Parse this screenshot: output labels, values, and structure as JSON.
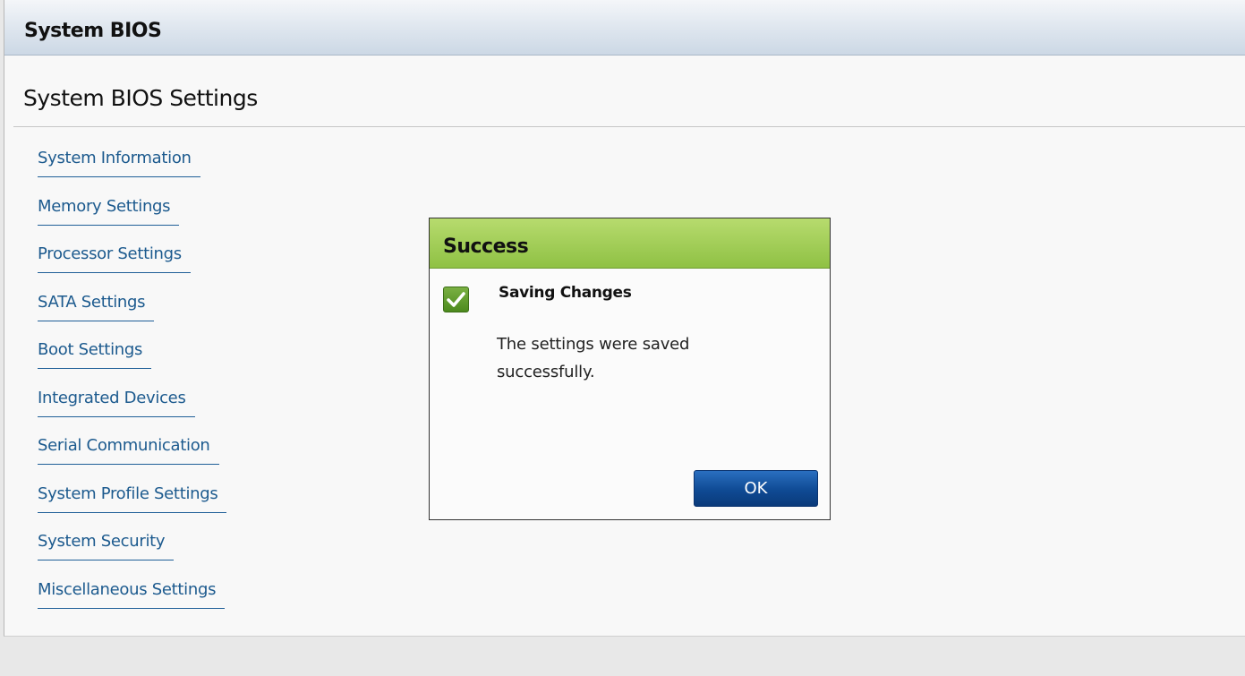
{
  "header": {
    "title": "System BIOS"
  },
  "section": {
    "title": "System BIOS Settings"
  },
  "nav": {
    "items": [
      {
        "label": "System Information"
      },
      {
        "label": "Memory Settings"
      },
      {
        "label": "Processor Settings"
      },
      {
        "label": "SATA Settings"
      },
      {
        "label": "Boot Settings"
      },
      {
        "label": "Integrated Devices"
      },
      {
        "label": "Serial Communication"
      },
      {
        "label": "System Profile Settings"
      },
      {
        "label": "System Security"
      },
      {
        "label": "Miscellaneous Settings"
      }
    ]
  },
  "dialog": {
    "title": "Success",
    "heading": "Saving Changes",
    "message": "The settings were saved successfully.",
    "ok_label": "OK",
    "icon": "check-icon"
  },
  "colors": {
    "link": "#1c5a8e",
    "success_header": "#9cc94f",
    "button": "#0f4a94"
  }
}
